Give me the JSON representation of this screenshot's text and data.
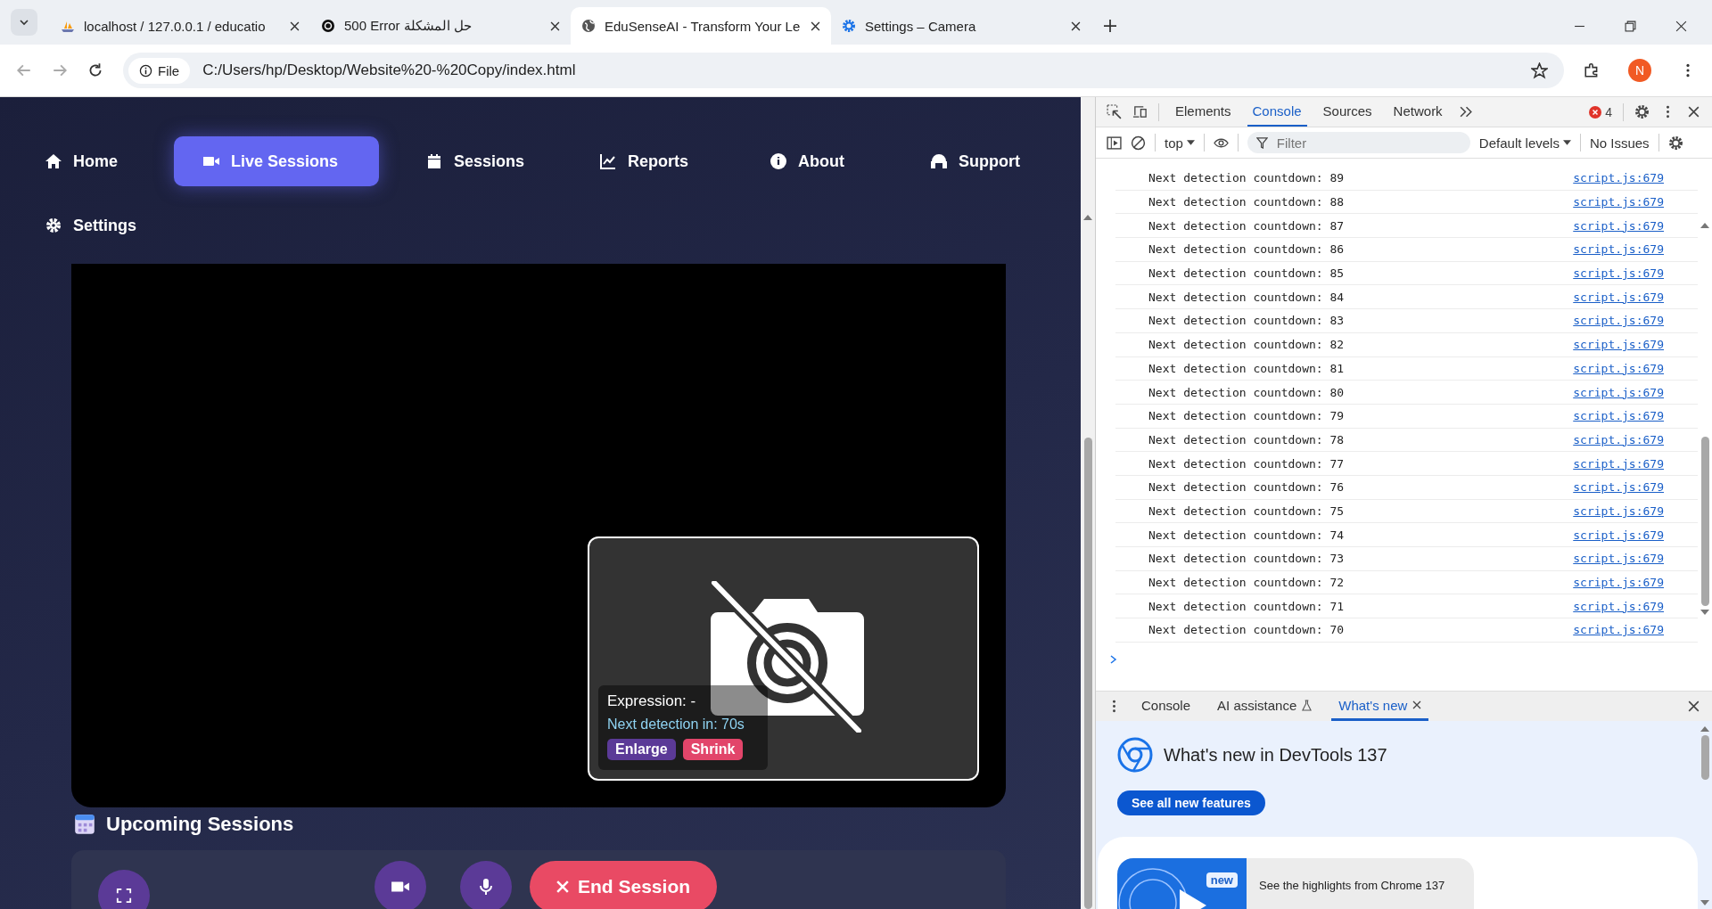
{
  "browser": {
    "tabs": [
      {
        "title": "localhost / 127.0.0.1 / educatio",
        "kind": "pma",
        "selected": false
      },
      {
        "title": "500 Error حل المشكلة",
        "kind": "ai",
        "selected": false
      },
      {
        "title": "EduSenseAI - Transform Your Le",
        "kind": "globe",
        "selected": true
      },
      {
        "title": "Settings – Camera",
        "kind": "gear",
        "selected": false
      }
    ],
    "scheme_label": "File",
    "url": "C:/Users/hp/Desktop/Website%20-%20Copy/index.html",
    "profile_initial": "N"
  },
  "nav": {
    "items": [
      {
        "label": "Home",
        "kind": "home",
        "selected": false
      },
      {
        "label": "Live Sessions",
        "kind": "video",
        "selected": true
      },
      {
        "label": "Sessions",
        "kind": "calendar",
        "selected": false
      },
      {
        "label": "Reports",
        "kind": "chart",
        "selected": false
      },
      {
        "label": "About",
        "kind": "info",
        "selected": false
      },
      {
        "label": "Support",
        "kind": "headset",
        "selected": false
      },
      {
        "label": "Settings",
        "kind": "gear",
        "selected": false
      }
    ]
  },
  "camera_preview": {
    "expression": "Expression: -",
    "countdown": "Next detection in: 70s",
    "buttons": [
      {
        "label": "Enlarge",
        "kind": "enlarge"
      },
      {
        "label": "Shrink",
        "kind": "shrink"
      }
    ]
  },
  "upcoming_title": "Upcoming Sessions",
  "session_controls": {
    "end_label": "End Session"
  },
  "devtools": {
    "tabs": [
      {
        "label": "Elements",
        "selected": false
      },
      {
        "label": "Console",
        "selected": true
      },
      {
        "label": "Sources",
        "selected": false
      },
      {
        "label": "Network",
        "selected": false
      }
    ],
    "error_count": "4",
    "context": "top",
    "filter_placeholder": "Filter",
    "levels": "Default levels",
    "issues": "No Issues",
    "messages": [
      {
        "text": "Next detection countdown: 89",
        "source": "script.js:679"
      },
      {
        "text": "Next detection countdown: 88",
        "source": "script.js:679"
      },
      {
        "text": "Next detection countdown: 87",
        "source": "script.js:679"
      },
      {
        "text": "Next detection countdown: 86",
        "source": "script.js:679"
      },
      {
        "text": "Next detection countdown: 85",
        "source": "script.js:679"
      },
      {
        "text": "Next detection countdown: 84",
        "source": "script.js:679"
      },
      {
        "text": "Next detection countdown: 83",
        "source": "script.js:679"
      },
      {
        "text": "Next detection countdown: 82",
        "source": "script.js:679"
      },
      {
        "text": "Next detection countdown: 81",
        "source": "script.js:679"
      },
      {
        "text": "Next detection countdown: 80",
        "source": "script.js:679"
      },
      {
        "text": "Next detection countdown: 79",
        "source": "script.js:679"
      },
      {
        "text": "Next detection countdown: 78",
        "source": "script.js:679"
      },
      {
        "text": "Next detection countdown: 77",
        "source": "script.js:679"
      },
      {
        "text": "Next detection countdown: 76",
        "source": "script.js:679"
      },
      {
        "text": "Next detection countdown: 75",
        "source": "script.js:679"
      },
      {
        "text": "Next detection countdown: 74",
        "source": "script.js:679"
      },
      {
        "text": "Next detection countdown: 73",
        "source": "script.js:679"
      },
      {
        "text": "Next detection countdown: 72",
        "source": "script.js:679"
      },
      {
        "text": "Next detection countdown: 71",
        "source": "script.js:679"
      },
      {
        "text": "Next detection countdown: 70",
        "source": "script.js:679"
      }
    ],
    "drawer": {
      "tabs": [
        {
          "label": "Console",
          "kind": "plain",
          "selected": false
        },
        {
          "label": "AI assistance",
          "kind": "lab",
          "selected": false
        },
        {
          "label": "What's new",
          "kind": "closable",
          "selected": true
        }
      ],
      "title": "What's new in DevTools 137",
      "button": "See all new features",
      "badge": "new",
      "highlight": "See the highlights from Chrome 137"
    }
  }
}
